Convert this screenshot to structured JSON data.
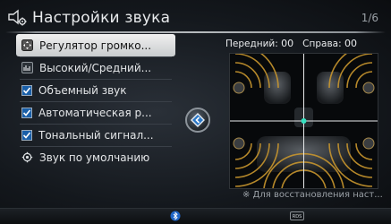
{
  "header": {
    "title": "Настройки звука",
    "page_indicator": "1/6"
  },
  "menu": {
    "items": [
      {
        "label": "Регулятор громко...",
        "icon": "dpad-icon",
        "active": true
      },
      {
        "label": "Высокий/Средний...",
        "icon": "equalizer-icon",
        "active": false
      },
      {
        "label": "Объемный звук",
        "icon": "checkbox-icon",
        "checked": true
      },
      {
        "label": "Автоматическая р...",
        "icon": "checkbox-icon",
        "checked": true
      },
      {
        "label": "Тональный сигнал...",
        "icon": "checkbox-icon",
        "checked": true
      },
      {
        "label": "Звук по умолчанию",
        "icon": "reset-gear-icon",
        "active": false
      }
    ]
  },
  "balance": {
    "front_label": "Передний:",
    "front_value": "00",
    "right_label": "Справа:",
    "right_value": "00"
  },
  "note": "※ Для восстановления наст...",
  "footer": {
    "bluetooth_icon": "bluetooth-icon",
    "fm_badge": "RDS"
  },
  "colors": {
    "accent_blue": "#1a5fa8",
    "active_item": "#e6e7e8",
    "wave_gold": "#c8962e",
    "center_marker": "#35e0c0"
  }
}
